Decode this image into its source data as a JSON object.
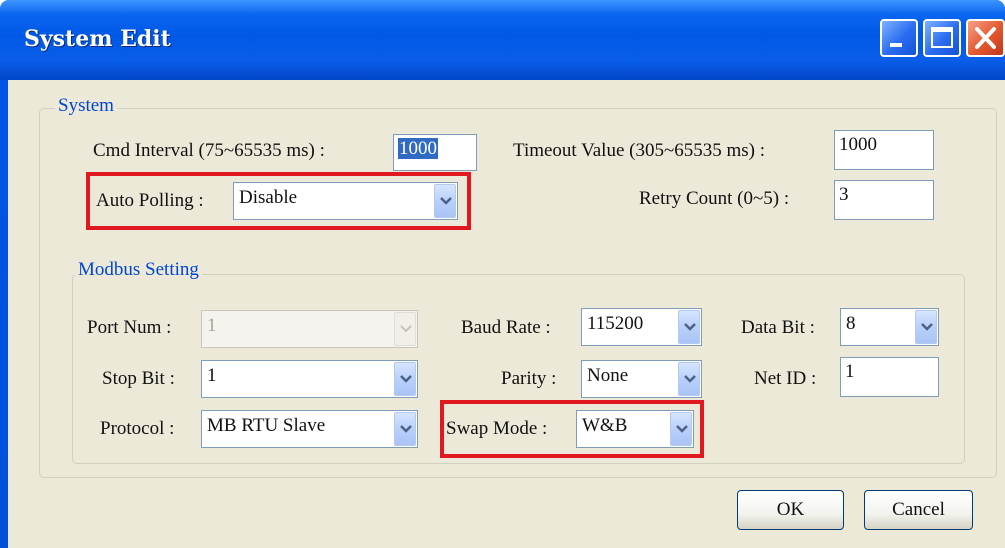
{
  "window": {
    "title": "System Edit"
  },
  "system_group": {
    "label": "System",
    "cmd_interval_label": "Cmd Interval (75~65535 ms) :",
    "cmd_interval_value": "1000",
    "timeout_label": "Timeout Value (305~65535 ms) :",
    "timeout_value": "1000",
    "auto_polling_label": "Auto Polling :",
    "auto_polling_value": "Disable",
    "retry_label": "Retry Count (0~5) :",
    "retry_value": "3"
  },
  "modbus_group": {
    "label": "Modbus Setting",
    "port_num_label": "Port Num :",
    "port_num_value": "1",
    "baud_rate_label": "Baud Rate :",
    "baud_rate_value": "115200",
    "data_bit_label": "Data Bit :",
    "data_bit_value": "8",
    "stop_bit_label": "Stop Bit :",
    "stop_bit_value": "1",
    "parity_label": "Parity :",
    "parity_value": "None",
    "net_id_label": "Net ID :",
    "net_id_value": "1",
    "protocol_label": "Protocol :",
    "protocol_value": "MB RTU Slave",
    "swap_mode_label": "Swap Mode :",
    "swap_mode_value": "W&B"
  },
  "buttons": {
    "ok": "OK",
    "cancel": "Cancel"
  },
  "colors": {
    "titlebar": "#0058e6",
    "dialog_face": "#ece9d8",
    "group_label": "#0046d5",
    "highlight": "#e1181f"
  },
  "icons": {
    "minimize": "minimize-icon",
    "maximize": "maximize-icon",
    "close": "close-icon",
    "dropdown": "chevron-down-icon"
  }
}
